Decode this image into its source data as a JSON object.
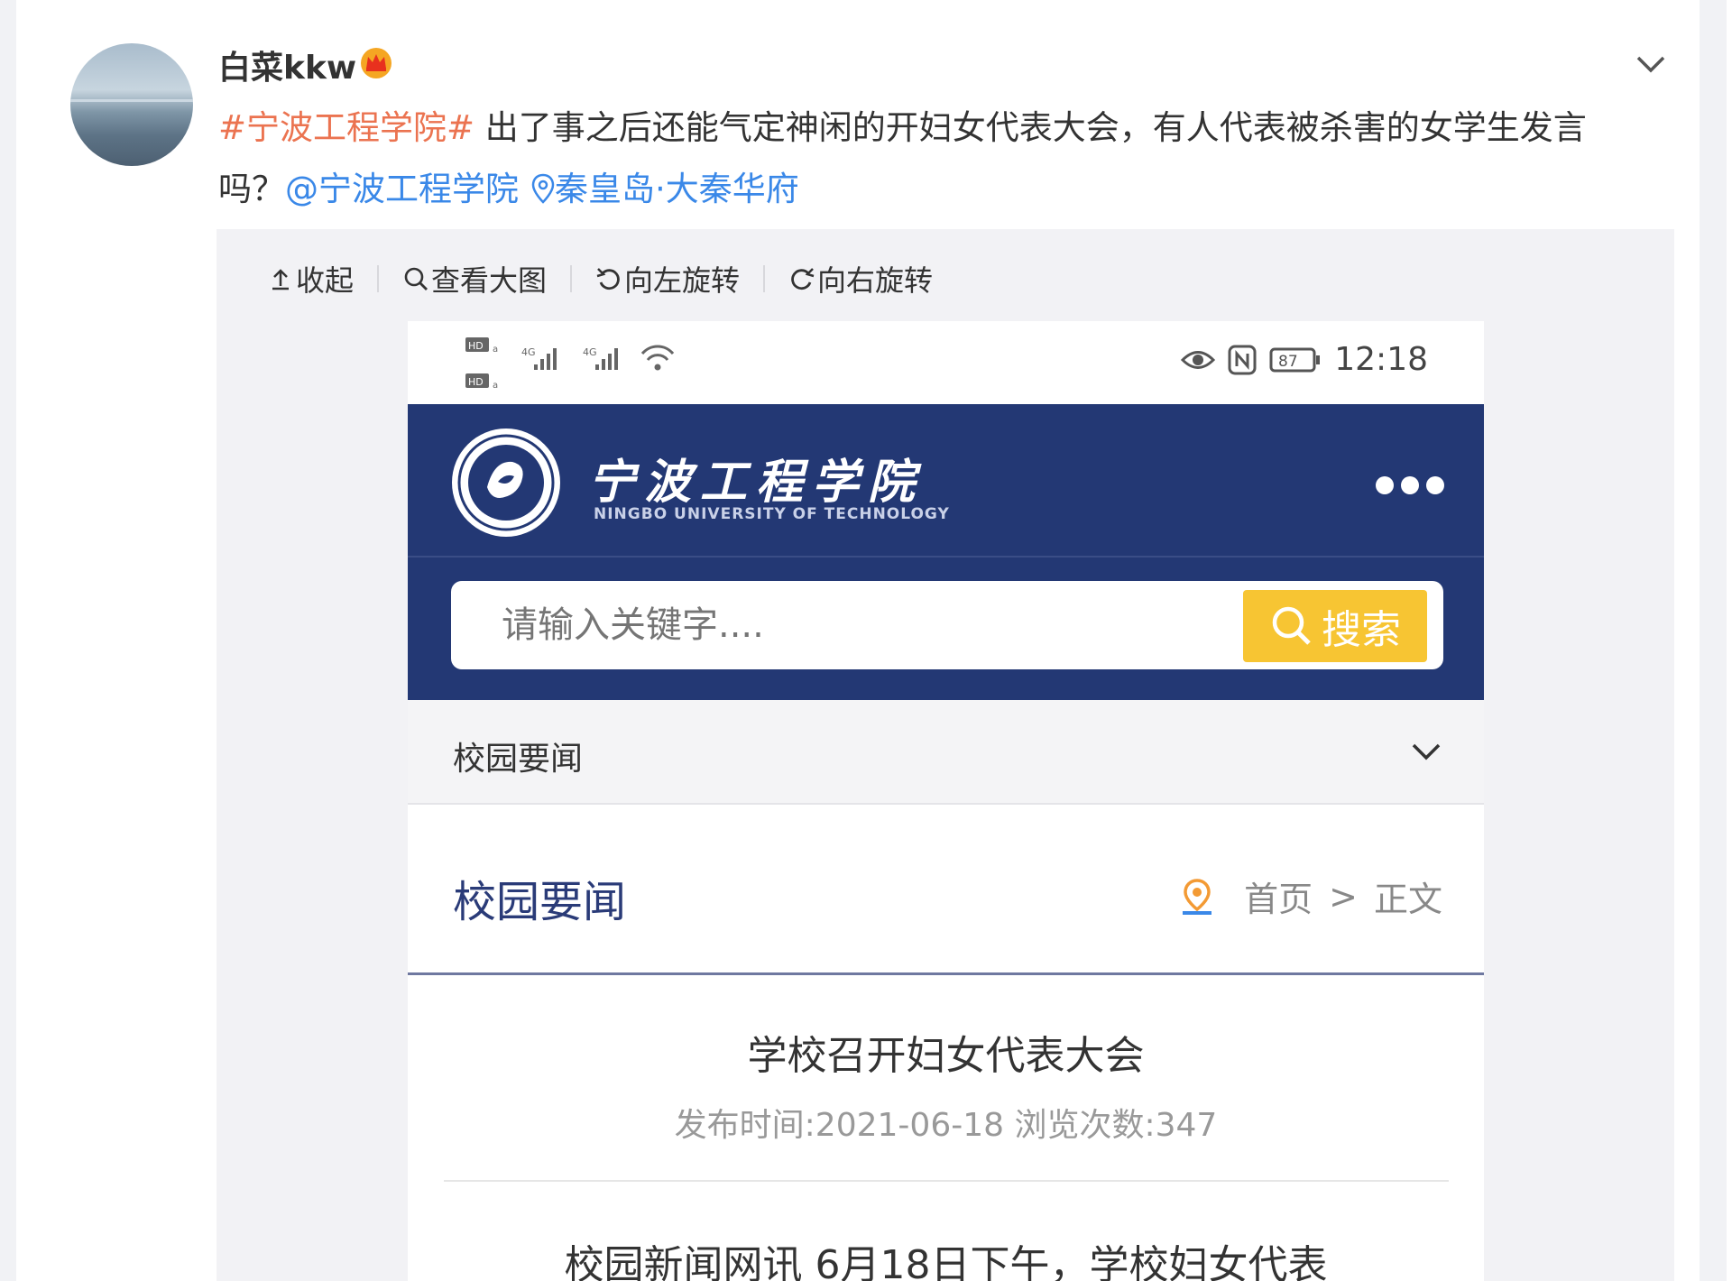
{
  "post": {
    "username": "白菜kkw",
    "hashtag": "#宁波工程学院#",
    "text": " 出了事之后还能气定神闲的开妇女代表大会，有人代表被杀害的女学生发言吗？",
    "mention": "@宁波工程学院",
    "location": "秦皇岛·大秦华府"
  },
  "toolbar": {
    "collapse": "收起",
    "view_large": "查看大图",
    "rotate_left": "向左旋转",
    "rotate_right": "向右旋转"
  },
  "phone": {
    "status_time": "12:18",
    "battery": "87",
    "school_name_cn": "宁波工程学院",
    "school_name_en": "NINGBO UNIVERSITY OF TECHNOLOGY",
    "search_placeholder": "请输入关键字....",
    "search_button": "搜索",
    "category_label": "校园要闻",
    "section_title": "校园要闻",
    "breadcrumb_home": "首页",
    "breadcrumb_sep": ">",
    "breadcrumb_current": "正文",
    "article_title": "学校召开妇女代表大会",
    "article_meta": "发布时间:2021-06-18 浏览次数:347",
    "article_body": "校园新闻网讯  6月18日下午，学校妇女代表"
  },
  "colors": {
    "hashtag": "#eb7350",
    "link": "#3a88e8",
    "header_navy": "#233874",
    "search_yellow": "#f7c533"
  },
  "icons": [
    "crown-icon",
    "chevron-down-icon",
    "location-pin-icon",
    "collapse-icon",
    "zoom-icon",
    "rotate-left-icon",
    "rotate-right-icon",
    "signal-icon",
    "wifi-icon",
    "eye-icon",
    "nfc-icon",
    "battery-icon",
    "school-logo",
    "more-dots-icon",
    "search-icon",
    "map-pin-icon"
  ]
}
